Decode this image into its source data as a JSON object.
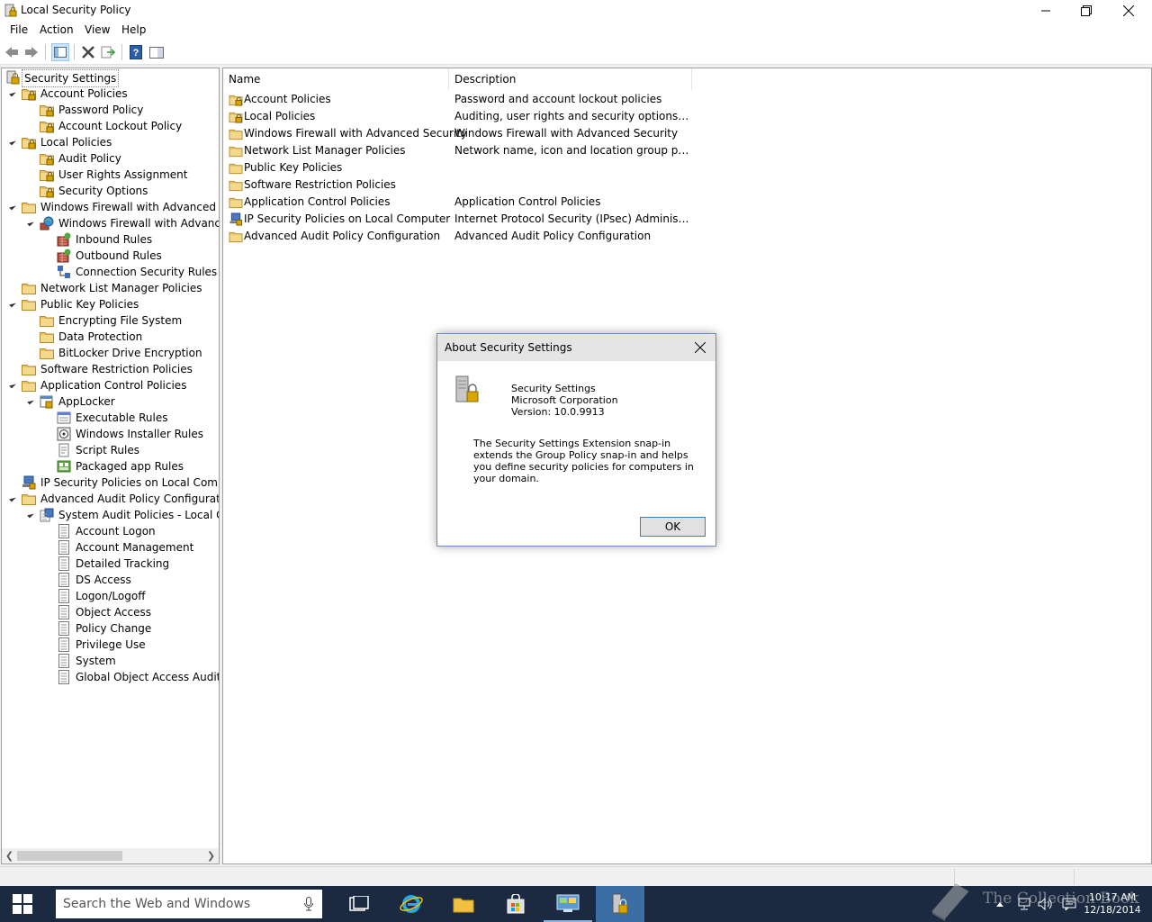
{
  "window": {
    "title": "Local Security Policy"
  },
  "menubar": {
    "items": [
      "File",
      "Action",
      "View",
      "Help"
    ]
  },
  "tree": {
    "root": "Security Settings",
    "items": [
      {
        "label": "Account Policies",
        "icon": "folder-lock-icon",
        "level": 1
      },
      {
        "label": "Password Policy",
        "icon": "folder-lock-icon",
        "level": 2
      },
      {
        "label": "Account Lockout Policy",
        "icon": "folder-lock-icon",
        "level": 2
      },
      {
        "label": "Local Policies",
        "icon": "folder-lock-icon",
        "level": 1
      },
      {
        "label": "Audit Policy",
        "icon": "folder-lock-icon",
        "level": 2
      },
      {
        "label": "User Rights Assignment",
        "icon": "folder-lock-icon",
        "level": 2
      },
      {
        "label": "Security Options",
        "icon": "folder-lock-icon",
        "level": 2
      },
      {
        "label": "Windows Firewall with Advanced Secu",
        "icon": "folder-icon",
        "level": 1
      },
      {
        "label": "Windows Firewall with Advanced",
        "icon": "firewall-globe-icon",
        "level": 2
      },
      {
        "label": "Inbound Rules",
        "icon": "inbound-rules-icon",
        "level": 3
      },
      {
        "label": "Outbound Rules",
        "icon": "outbound-rules-icon",
        "level": 3
      },
      {
        "label": "Connection Security Rules",
        "icon": "connection-security-icon",
        "level": 3
      },
      {
        "label": "Network List Manager Policies",
        "icon": "folder-icon",
        "level": 1
      },
      {
        "label": "Public Key Policies",
        "icon": "folder-icon",
        "level": 1
      },
      {
        "label": "Encrypting File System",
        "icon": "folder-icon",
        "level": 2
      },
      {
        "label": "Data Protection",
        "icon": "folder-icon",
        "level": 2
      },
      {
        "label": "BitLocker Drive Encryption",
        "icon": "folder-icon",
        "level": 2
      },
      {
        "label": "Software Restriction Policies",
        "icon": "folder-icon",
        "level": 1
      },
      {
        "label": "Application Control Policies",
        "icon": "folder-icon",
        "level": 1
      },
      {
        "label": "AppLocker",
        "icon": "applocker-icon",
        "level": 2
      },
      {
        "label": "Executable Rules",
        "icon": "executable-rules-icon",
        "level": 3
      },
      {
        "label": "Windows Installer Rules",
        "icon": "installer-rules-icon",
        "level": 3
      },
      {
        "label": "Script Rules",
        "icon": "script-rules-icon",
        "level": 3
      },
      {
        "label": "Packaged app Rules",
        "icon": "packaged-app-icon",
        "level": 3
      },
      {
        "label": "IP Security Policies on Local Compute",
        "icon": "ipsec-icon",
        "level": 1
      },
      {
        "label": "Advanced Audit Policy Configuration",
        "icon": "folder-icon",
        "level": 1
      },
      {
        "label": "System Audit Policies - Local Grou",
        "icon": "audit-policies-icon",
        "level": 2
      },
      {
        "label": "Account Logon",
        "icon": "audit-category-icon",
        "level": 3
      },
      {
        "label": "Account Management",
        "icon": "audit-category-icon",
        "level": 3
      },
      {
        "label": "Detailed Tracking",
        "icon": "audit-category-icon",
        "level": 3
      },
      {
        "label": "DS Access",
        "icon": "audit-category-icon",
        "level": 3
      },
      {
        "label": "Logon/Logoff",
        "icon": "audit-category-icon",
        "level": 3
      },
      {
        "label": "Object Access",
        "icon": "audit-category-icon",
        "level": 3
      },
      {
        "label": "Policy Change",
        "icon": "audit-category-icon",
        "level": 3
      },
      {
        "label": "Privilege Use",
        "icon": "audit-category-icon",
        "level": 3
      },
      {
        "label": "System",
        "icon": "audit-category-icon",
        "level": 3
      },
      {
        "label": "Global Object Access Auditing",
        "icon": "audit-category-icon",
        "level": 3
      }
    ]
  },
  "list": {
    "columns": [
      "Name",
      "Description"
    ],
    "rows": [
      {
        "name": "Account Policies",
        "description": "Password and account lockout policies",
        "icon": "folder-lock-icon"
      },
      {
        "name": "Local Policies",
        "description": "Auditing, user rights and security options polici...",
        "icon": "folder-lock-icon"
      },
      {
        "name": "Windows Firewall with Advanced Security",
        "description": "Windows Firewall with Advanced Security",
        "icon": "folder-icon"
      },
      {
        "name": "Network List Manager Policies",
        "description": "Network name, icon and location group policies.",
        "icon": "folder-icon"
      },
      {
        "name": "Public Key Policies",
        "description": "",
        "icon": "folder-icon"
      },
      {
        "name": "Software Restriction Policies",
        "description": "",
        "icon": "folder-icon"
      },
      {
        "name": "Application Control Policies",
        "description": "Application Control Policies",
        "icon": "folder-icon"
      },
      {
        "name": "IP Security Policies on Local Computer",
        "description": "Internet Protocol Security (IPsec) Administratio...",
        "icon": "ipsec-icon"
      },
      {
        "name": "Advanced Audit Policy Configuration",
        "description": "Advanced Audit Policy Configuration",
        "icon": "folder-icon"
      }
    ]
  },
  "dialog": {
    "title": "About Security Settings",
    "product": "Security Settings",
    "company": "Microsoft Corporation",
    "version": "Version: 10.0.9913",
    "description": "The Security Settings Extension snap-in extends the Group Policy snap-in and helps you define security policies for computers in your domain.",
    "ok_label": "OK"
  },
  "taskbar": {
    "search_placeholder": "Search the Web and Windows",
    "time": "10:17 AM",
    "date": "12/18/2014",
    "watermark": "The Collection Book"
  },
  "colors": {
    "taskbar": "#1b2a41",
    "active_app": "#3a6ea5",
    "folder": "#e8c164",
    "dialog_border": "#6b8cc3"
  }
}
